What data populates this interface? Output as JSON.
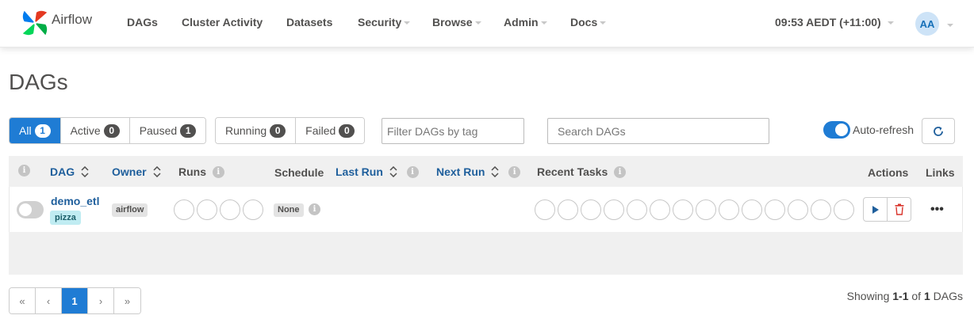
{
  "nav": {
    "brand": "Airflow",
    "items": [
      {
        "label": "DAGs",
        "dropdown": false
      },
      {
        "label": "Cluster Activity",
        "dropdown": false
      },
      {
        "label": "Datasets",
        "dropdown": false
      },
      {
        "label": "Security",
        "dropdown": true
      },
      {
        "label": "Browse",
        "dropdown": true
      },
      {
        "label": "Admin",
        "dropdown": true
      },
      {
        "label": "Docs",
        "dropdown": true
      }
    ],
    "time": "09:53 AEDT (+11:00)",
    "avatar": "AA"
  },
  "page_title": "DAGs",
  "status_filters": [
    {
      "label": "All",
      "count": "1",
      "active": true
    },
    {
      "label": "Active",
      "count": "0",
      "active": false
    },
    {
      "label": "Paused",
      "count": "1",
      "active": false
    }
  ],
  "run_filters": [
    {
      "label": "Running",
      "count": "0"
    },
    {
      "label": "Failed",
      "count": "0"
    }
  ],
  "tag_filter": {
    "placeholder": "Filter DAGs by tag"
  },
  "search": {
    "placeholder": "Search DAGs"
  },
  "auto_refresh": {
    "label": "Auto-refresh",
    "enabled": true
  },
  "table": {
    "columns": {
      "dag": "DAG",
      "owner": "Owner",
      "runs": "Runs",
      "schedule": "Schedule",
      "last_run": "Last Run",
      "next_run": "Next Run",
      "recent_tasks": "Recent Tasks",
      "actions": "Actions",
      "links": "Links"
    },
    "rows": [
      {
        "paused": true,
        "dag_id": "demo_etl",
        "tag": "pizza",
        "owner": "airflow",
        "schedule": "None",
        "run_circles": 4,
        "task_circles": 14
      }
    ]
  },
  "pagination": {
    "first": "«",
    "prev": "‹",
    "current": "1",
    "next": "›",
    "last": "»"
  },
  "showing": {
    "prefix": "Showing",
    "range": "1-1",
    "of": "of",
    "total": "1",
    "suffix": "DAGs"
  },
  "colors": {
    "accent": "#1f7cd4",
    "link": "#1f5f9c",
    "text": "#51504f"
  }
}
